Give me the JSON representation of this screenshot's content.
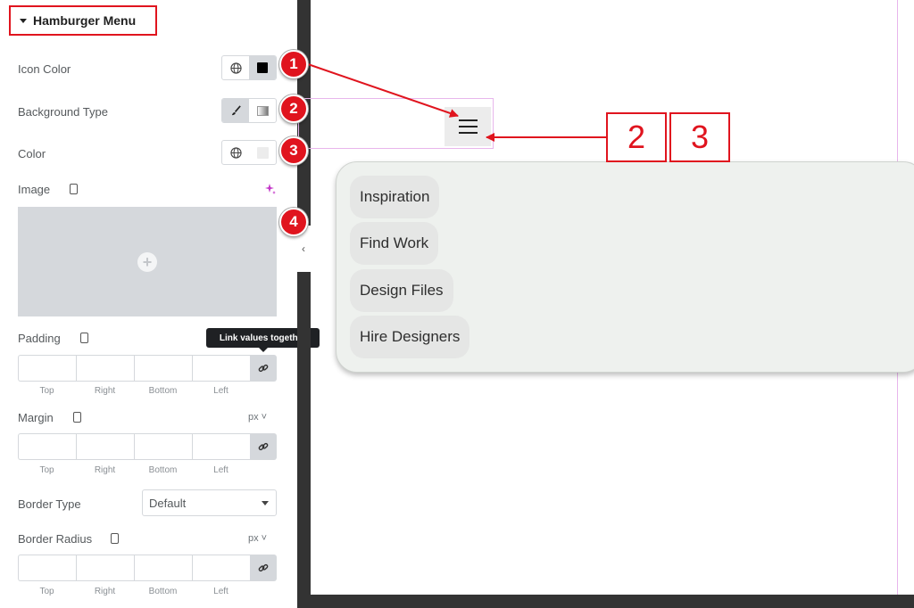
{
  "panel": {
    "section_title": "Hamburger Menu",
    "icon_color_label": "Icon Color",
    "background_type_label": "Background Type",
    "color_label": "Color",
    "image_label": "Image",
    "padding_label": "Padding",
    "margin_label": "Margin",
    "margin_unit": "px ˅",
    "border_type_label": "Border Type",
    "border_type_value": "Default",
    "border_radius_label": "Border Radius",
    "border_radius_unit": "px ˅",
    "side_labels": [
      "Top",
      "Right",
      "Bottom",
      "Left"
    ],
    "tooltip": "Link values together"
  },
  "colors": {
    "accent_red": "#e0141e",
    "icon_color": "#000000",
    "bg_color": "#ececec"
  },
  "preview": {
    "menu_items": [
      "Inspiration",
      "Find Work",
      "Design Files",
      "Hire Designers"
    ]
  },
  "annotations": {
    "badges": [
      "1",
      "2",
      "3",
      "4"
    ],
    "boxes": [
      "2",
      "3"
    ]
  }
}
